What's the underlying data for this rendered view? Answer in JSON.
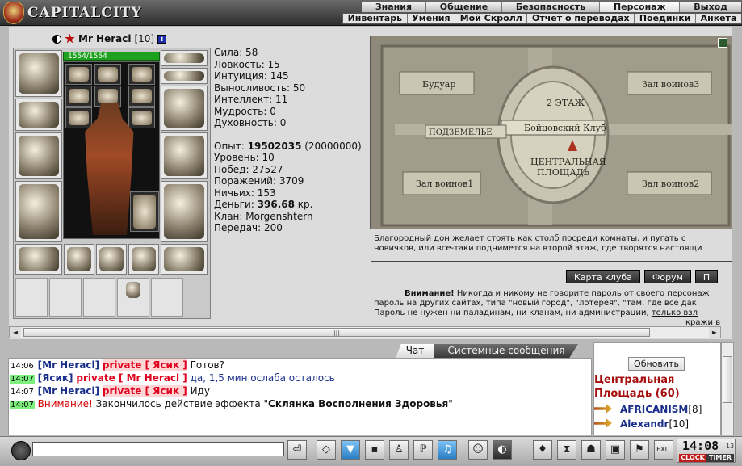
{
  "header": {
    "logo_text": "CAPITALCITY",
    "main_menu": [
      {
        "label": "Знания",
        "active": false
      },
      {
        "label": "Общение",
        "active": false
      },
      {
        "label": "Безопасность",
        "active": false
      },
      {
        "label": "Персонаж",
        "active": true
      },
      {
        "label": "Выход",
        "active": false
      }
    ],
    "sub_menu": [
      "Инвентарь",
      "Умения",
      "Мой Скролл",
      "Отчет о переводах",
      "Поединки",
      "Анкета"
    ]
  },
  "character": {
    "name": "Mr Heracl",
    "level": "[10]",
    "info_icon": "i",
    "hp_text": "1554/1554",
    "hp_fraction": 1.0
  },
  "stats": {
    "strength": "Сила: 58",
    "agility": "Ловкость: 15",
    "intuition": "Интуиция: 145",
    "endurance": "Выносливость: 50",
    "intellect": "Интеллект: 11",
    "wisdom": "Мудрость: 0",
    "spirit": "Духовность: 0",
    "exp_label": "Опыт: ",
    "exp_value": "19502035",
    "exp_next": " (20000000)",
    "level_line": "Уровень: 10",
    "wins": "Побед: 27527",
    "losses": "Поражений: 3709",
    "draws": "Ничьих: 153",
    "money_label": "Деньги: ",
    "money_value": "396.68",
    "money_unit": " кр.",
    "clan": "Клан: Morgenshtern",
    "transfers": "Передач: 200"
  },
  "map": {
    "room_budoar": "Будуар",
    "room_warriors3": "Зал воинов3",
    "floor2": "2 ЭТАЖ",
    "fight_club": "Бойцовский Клуб",
    "dungeon": "ПОДЗЕМЕЛЬЕ",
    "central_1": "ЦЕНТРАЛЬНАЯ",
    "central_2": "ПЛОЩАДЬ",
    "room_warriors1": "Зал воинов1",
    "room_warriors2": "Зал воинов2",
    "description_1": "Благородный дон желает стоять как столб посреди комнаты, и пугать с",
    "description_2": "новичков, или все-таки поднимется на второй этаж, где творятся настоящи",
    "btn_club_map": "Карта клуба",
    "btn_forum": "Форум",
    "btn_more": "П",
    "warning_bold": "Внимание!",
    "warning_1": " Никогда и никому не говорите пароль от своего персонаж",
    "warning_2": "пароль на других сайтах, типа \"новый город\", \"лотерея\", \"там, где все дак",
    "warning_3": "Пароль не нужен ни паладинам, ни кланам, ни администрации, ",
    "warning_link": "только взл",
    "warning_4": "кражи в"
  },
  "scrollbar": {
    "left": "◄",
    "grip": "|||",
    "right": "►"
  },
  "chat": {
    "tab_chat": "Чат",
    "tab_system": "Системные сообщения",
    "lines": [
      {
        "time": "14:06",
        "nick": "[Mr Heracl]",
        "priv": "private [ Ясик ]",
        "msg": " Готов?"
      },
      {
        "time": "14:07",
        "nick": "[Ясик]",
        "priv": "private [ Mr Heracl ]",
        "msg": " да, 1,5 мин ослаба осталось"
      },
      {
        "time": "14:07",
        "nick": "[Mr Heracl]",
        "priv": "private [ Ясик ]",
        "msg": " Иду"
      },
      {
        "time": "14:07",
        "warn": "Внимание!",
        "msg": " Закончилось действие эффекта \"",
        "bold": "Склянка Восполнения Здоровья",
        "tail": "\""
      }
    ]
  },
  "online": {
    "refresh_label": "Обновить",
    "room_title": "Центральная Площадь (60)",
    "users": [
      {
        "nick": "AFRICANISM",
        "level": "[8]"
      },
      {
        "nick": "Alexandr",
        "level": "[10]"
      }
    ]
  },
  "toolbar": {
    "input_value": "",
    "clock_time": "14:08",
    "clock_sec": "13",
    "clock_label": "CLOCK",
    "timer_label": "TIMER",
    "exit_label": "EXIT"
  },
  "colors": {
    "hp_bar": "#1ea11e",
    "private_red": "#e0001e",
    "nick_blue": "#1a2f8a",
    "room_title": "#a60d0d",
    "time_green": "#7df07d"
  }
}
